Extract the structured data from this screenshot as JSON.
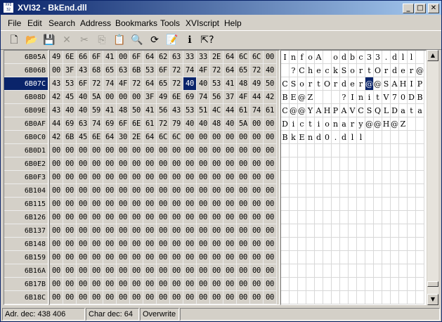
{
  "window": {
    "title": "XVI32 - BkEnd.dll",
    "app_icon_text": "XVI 32"
  },
  "menu": [
    "File",
    "Edit",
    "Search",
    "Address",
    "Bookmarks",
    "Tools",
    "XVIscript",
    "Help"
  ],
  "toolbar": [
    {
      "name": "new-file-icon",
      "glyph": "🗋",
      "enabled": true
    },
    {
      "name": "open-folder-icon",
      "glyph": "📂",
      "enabled": true
    },
    {
      "name": "save-disk-icon",
      "glyph": "💾",
      "enabled": true
    },
    {
      "name": "delete-x-icon",
      "glyph": "✕",
      "enabled": false
    },
    {
      "name": "cut-icon",
      "glyph": "✂",
      "enabled": false
    },
    {
      "name": "copy-icon",
      "glyph": "⎘",
      "enabled": false
    },
    {
      "name": "paste-icon",
      "glyph": "📋",
      "enabled": false
    },
    {
      "name": "find-magnifier-icon",
      "glyph": "🔍",
      "enabled": true
    },
    {
      "name": "replace-icon",
      "glyph": "⟳",
      "enabled": true
    },
    {
      "name": "properties-icon",
      "glyph": "📝",
      "enabled": true
    },
    {
      "name": "info-icon",
      "glyph": "ℹ",
      "enabled": true
    },
    {
      "name": "context-help-icon",
      "glyph": "⇱?",
      "enabled": true
    }
  ],
  "addresses": [
    "6B05A",
    "6B06B",
    "6B07C",
    "6B08D",
    "6B09E",
    "6B0AF",
    "6B0C0",
    "6B0D1",
    "6B0E2",
    "6B0F3",
    "6B104",
    "6B115",
    "6B126",
    "6B137",
    "6B148",
    "6B159",
    "6B16A",
    "6B17B",
    "6B18C"
  ],
  "selected_address_row": 2,
  "cursor": {
    "row": 2,
    "col": 10
  },
  "hex_rows": [
    [
      "49",
      "6E",
      "66",
      "6F",
      "41",
      "00",
      "6F",
      "64",
      "62",
      "63",
      "33",
      "33",
      "2E",
      "64",
      "6C",
      "6C",
      "00"
    ],
    [
      "00",
      "3F",
      "43",
      "68",
      "65",
      "63",
      "6B",
      "53",
      "6F",
      "72",
      "74",
      "4F",
      "72",
      "64",
      "65",
      "72",
      "40"
    ],
    [
      "43",
      "53",
      "6F",
      "72",
      "74",
      "4F",
      "72",
      "64",
      "65",
      "72",
      "40",
      "40",
      "53",
      "41",
      "48",
      "49",
      "50"
    ],
    [
      "42",
      "45",
      "40",
      "5A",
      "00",
      "00",
      "00",
      "3F",
      "49",
      "6E",
      "69",
      "74",
      "56",
      "37",
      "4F",
      "44",
      "42"
    ],
    [
      "43",
      "40",
      "40",
      "59",
      "41",
      "48",
      "50",
      "41",
      "56",
      "43",
      "53",
      "51",
      "4C",
      "44",
      "61",
      "74",
      "61"
    ],
    [
      "44",
      "69",
      "63",
      "74",
      "69",
      "6F",
      "6E",
      "61",
      "72",
      "79",
      "40",
      "40",
      "48",
      "40",
      "5A",
      "00",
      "00"
    ],
    [
      "42",
      "6B",
      "45",
      "6E",
      "64",
      "30",
      "2E",
      "64",
      "6C",
      "6C",
      "00",
      "00",
      "00",
      "00",
      "00",
      "00",
      "00"
    ],
    [
      "00",
      "00",
      "00",
      "00",
      "00",
      "00",
      "00",
      "00",
      "00",
      "00",
      "00",
      "00",
      "00",
      "00",
      "00",
      "00",
      "00"
    ],
    [
      "00",
      "00",
      "00",
      "00",
      "00",
      "00",
      "00",
      "00",
      "00",
      "00",
      "00",
      "00",
      "00",
      "00",
      "00",
      "00",
      "00"
    ],
    [
      "00",
      "00",
      "00",
      "00",
      "00",
      "00",
      "00",
      "00",
      "00",
      "00",
      "00",
      "00",
      "00",
      "00",
      "00",
      "00",
      "00"
    ],
    [
      "00",
      "00",
      "00",
      "00",
      "00",
      "00",
      "00",
      "00",
      "00",
      "00",
      "00",
      "00",
      "00",
      "00",
      "00",
      "00",
      "00"
    ],
    [
      "00",
      "00",
      "00",
      "00",
      "00",
      "00",
      "00",
      "00",
      "00",
      "00",
      "00",
      "00",
      "00",
      "00",
      "00",
      "00",
      "00"
    ],
    [
      "00",
      "00",
      "00",
      "00",
      "00",
      "00",
      "00",
      "00",
      "00",
      "00",
      "00",
      "00",
      "00",
      "00",
      "00",
      "00",
      "00"
    ],
    [
      "00",
      "00",
      "00",
      "00",
      "00",
      "00",
      "00",
      "00",
      "00",
      "00",
      "00",
      "00",
      "00",
      "00",
      "00",
      "00",
      "00"
    ],
    [
      "00",
      "00",
      "00",
      "00",
      "00",
      "00",
      "00",
      "00",
      "00",
      "00",
      "00",
      "00",
      "00",
      "00",
      "00",
      "00",
      "00"
    ],
    [
      "00",
      "00",
      "00",
      "00",
      "00",
      "00",
      "00",
      "00",
      "00",
      "00",
      "00",
      "00",
      "00",
      "00",
      "00",
      "00",
      "00"
    ],
    [
      "00",
      "00",
      "00",
      "00",
      "00",
      "00",
      "00",
      "00",
      "00",
      "00",
      "00",
      "00",
      "00",
      "00",
      "00",
      "00",
      "00"
    ],
    [
      "00",
      "00",
      "00",
      "00",
      "00",
      "00",
      "00",
      "00",
      "00",
      "00",
      "00",
      "00",
      "00",
      "00",
      "00",
      "00",
      "00"
    ],
    [
      "00",
      "00",
      "00",
      "00",
      "00",
      "00",
      "00",
      "00",
      "00",
      "00",
      "00",
      "00",
      "00",
      "00",
      "00",
      "00",
      "00"
    ]
  ],
  "text_rows": [
    [
      "I",
      "n",
      "f",
      "o",
      "A",
      " ",
      "o",
      "d",
      "b",
      "c",
      "3",
      "3",
      ".",
      "d",
      "l",
      "l",
      " "
    ],
    [
      " ",
      "?",
      "C",
      "h",
      "e",
      "c",
      "k",
      "S",
      "o",
      "r",
      "t",
      "O",
      "r",
      "d",
      "e",
      "r",
      "@"
    ],
    [
      "C",
      "S",
      "o",
      "r",
      "t",
      "O",
      "r",
      "d",
      "e",
      "r",
      "@",
      "@",
      "S",
      "A",
      "H",
      "I",
      "P"
    ],
    [
      "B",
      "E",
      "@",
      "Z",
      " ",
      " ",
      " ",
      "?",
      "I",
      "n",
      "i",
      "t",
      "V",
      "7",
      "0",
      "D",
      "B"
    ],
    [
      "C",
      "@",
      "@",
      "Y",
      "A",
      "H",
      "P",
      "A",
      "V",
      "C",
      "S",
      "Q",
      "L",
      "D",
      "a",
      "t",
      "a"
    ],
    [
      "D",
      "i",
      "c",
      "t",
      "i",
      "o",
      "n",
      "a",
      "r",
      "y",
      "@",
      "@",
      "H",
      "@",
      "Z",
      " ",
      " "
    ],
    [
      "B",
      "k",
      "E",
      "n",
      "d",
      "0",
      ".",
      "d",
      "l",
      "l",
      " ",
      " ",
      " ",
      " ",
      " ",
      " ",
      " "
    ]
  ],
  "status": {
    "address": "Adr. dec: 438 406",
    "char": "Char dec: 64",
    "mode": "Overwrite"
  }
}
